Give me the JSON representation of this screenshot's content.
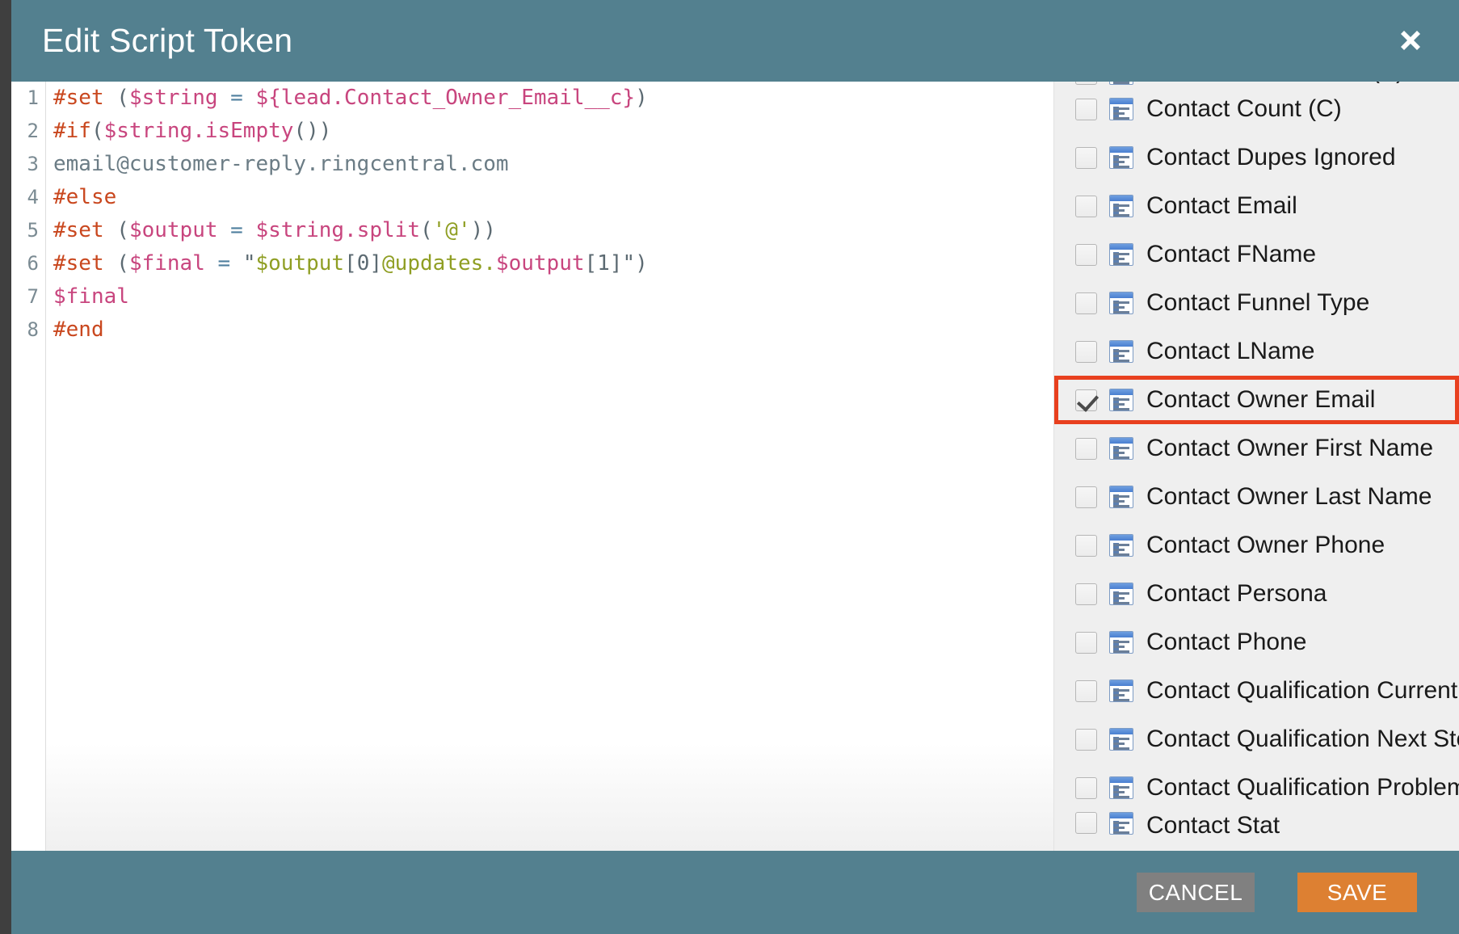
{
  "window": {
    "title": "Edit Script Token",
    "close_icon": "close-icon"
  },
  "editor": {
    "language": "velocity",
    "line_numbers": [
      "1",
      "2",
      "3",
      "4",
      "5",
      "6",
      "7",
      "8"
    ],
    "lines": [
      [
        {
          "t": "#set ",
          "c": "tk-directive"
        },
        {
          "t": "(",
          "c": "tk-punct"
        },
        {
          "t": "$string",
          "c": "tk-var"
        },
        {
          "t": " = ",
          "c": "tk-op"
        },
        {
          "t": "${lead.Contact_Owner_Email__c}",
          "c": "tk-var"
        },
        {
          "t": ")",
          "c": "tk-punct"
        }
      ],
      [
        {
          "t": "#if",
          "c": "tk-directive"
        },
        {
          "t": "(",
          "c": "tk-punct"
        },
        {
          "t": "$string.isEmpty",
          "c": "tk-var"
        },
        {
          "t": "())",
          "c": "tk-punct"
        }
      ],
      [
        {
          "t": "email@customer-reply.ringcentral.com",
          "c": "tk-plain"
        }
      ],
      [
        {
          "t": "#else",
          "c": "tk-directive"
        }
      ],
      [
        {
          "t": "#set ",
          "c": "tk-directive"
        },
        {
          "t": "(",
          "c": "tk-punct"
        },
        {
          "t": "$output",
          "c": "tk-var"
        },
        {
          "t": " = ",
          "c": "tk-op"
        },
        {
          "t": "$string.split",
          "c": "tk-var"
        },
        {
          "t": "(",
          "c": "tk-punct"
        },
        {
          "t": "'@'",
          "c": "tk-string"
        },
        {
          "t": "))",
          "c": "tk-punct"
        }
      ],
      [
        {
          "t": "#set ",
          "c": "tk-directive"
        },
        {
          "t": "(",
          "c": "tk-punct"
        },
        {
          "t": "$final",
          "c": "tk-var"
        },
        {
          "t": " = ",
          "c": "tk-op"
        },
        {
          "t": "\"",
          "c": "tk-punct"
        },
        {
          "t": "$output",
          "c": "tk-string"
        },
        {
          "t": "[0]",
          "c": "tk-punct"
        },
        {
          "t": "@updates.",
          "c": "tk-string"
        },
        {
          "t": "$output",
          "c": "tk-var"
        },
        {
          "t": "[1]",
          "c": "tk-punct"
        },
        {
          "t": "\")",
          "c": "tk-punct"
        }
      ],
      [
        {
          "t": "$final",
          "c": "tk-var"
        }
      ],
      [
        {
          "t": "#end",
          "c": "tk-directive"
        }
      ]
    ],
    "plain_text": "#set ($string = ${lead.Contact_Owner_Email__c})\n#if($string.isEmpty())\nemail@customer-reply.ringcentral.com\n#else\n#set ($output = $string.split('@'))\n#set ($final = \"$output[0]@updates.$output[1]\")\n$final\n#end"
  },
  "field_panel": {
    "field_icon": "text-field-icon",
    "fields": [
      {
        "label": "Contact Center TAM (A)",
        "checked": false,
        "clip": "top"
      },
      {
        "label": "Contact Count (C)",
        "checked": false,
        "clip": "none"
      },
      {
        "label": "Contact Dupes Ignored",
        "checked": false,
        "clip": "none"
      },
      {
        "label": "Contact Email",
        "checked": false,
        "clip": "none"
      },
      {
        "label": "Contact FName",
        "checked": false,
        "clip": "none"
      },
      {
        "label": "Contact Funnel Type",
        "checked": false,
        "clip": "none"
      },
      {
        "label": "Contact LName",
        "checked": false,
        "clip": "none"
      },
      {
        "label": "Contact Owner Email",
        "checked": true,
        "clip": "none",
        "highlighted": true
      },
      {
        "label": "Contact Owner First Name",
        "checked": false,
        "clip": "none"
      },
      {
        "label": "Contact Owner Last Name",
        "checked": false,
        "clip": "none"
      },
      {
        "label": "Contact Owner Phone",
        "checked": false,
        "clip": "none"
      },
      {
        "label": "Contact Persona",
        "checked": false,
        "clip": "none"
      },
      {
        "label": "Contact Phone",
        "checked": false,
        "clip": "none"
      },
      {
        "label": "Contact Qualification Current S",
        "checked": false,
        "clip": "none"
      },
      {
        "label": "Contact Qualification Next Step",
        "checked": false,
        "clip": "none"
      },
      {
        "label": "Contact Qualification Problems",
        "checked": false,
        "clip": "none"
      },
      {
        "label": "Contact Stat",
        "checked": false,
        "clip": "bottom"
      }
    ]
  },
  "footer": {
    "cancel_label": "CANCEL",
    "save_label": "SAVE"
  },
  "colors": {
    "header_teal": "#53808f",
    "save_orange": "#dd8032",
    "cancel_gray": "#808080",
    "highlight_red": "#e8401f",
    "panel_gray": "#efefef"
  }
}
